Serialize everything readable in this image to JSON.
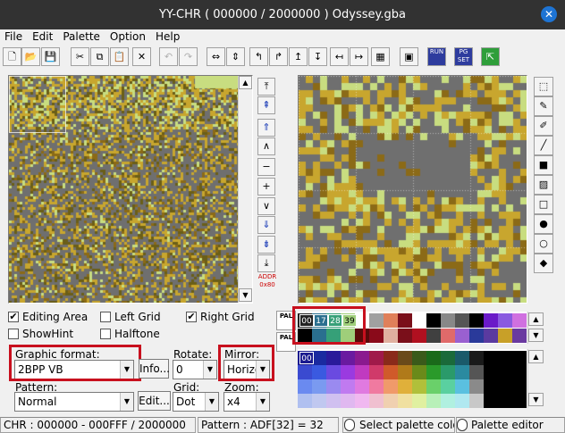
{
  "window": {
    "title": "YY-CHR ( 000000 / 2000000 ) Odyssey.gba",
    "close_glyph": "✕"
  },
  "menu": [
    "File",
    "Edit",
    "Palette",
    "Option",
    "Help"
  ],
  "toolbar": {
    "buttons": [
      {
        "name": "new-file-icon",
        "glyph": "🗋",
        "enabled": true
      },
      {
        "name": "open-folder-icon",
        "glyph": "📂",
        "enabled": true
      },
      {
        "name": "save-icon",
        "glyph": "💾",
        "enabled": true
      },
      {
        "name": "cut-icon",
        "glyph": "✂",
        "enabled": true
      },
      {
        "name": "copy-icon",
        "glyph": "⧉",
        "enabled": true
      },
      {
        "name": "paste-icon",
        "glyph": "📋",
        "enabled": true
      },
      {
        "name": "delete-icon",
        "glyph": "✕",
        "enabled": true
      },
      {
        "name": "undo-icon",
        "glyph": "↶",
        "enabled": false
      },
      {
        "name": "redo-icon",
        "glyph": "↷",
        "enabled": false
      },
      {
        "name": "flip-horizontal-icon",
        "glyph": "⇔",
        "enabled": true
      },
      {
        "name": "flip-vertical-icon",
        "glyph": "⇕",
        "enabled": true
      },
      {
        "name": "rotate-left-icon",
        "glyph": "↰",
        "enabled": true
      },
      {
        "name": "rotate-right-icon",
        "glyph": "↱",
        "enabled": true
      },
      {
        "name": "shift-up-icon",
        "glyph": "↥",
        "enabled": true
      },
      {
        "name": "shift-down-icon",
        "glyph": "↧",
        "enabled": true
      },
      {
        "name": "shift-left-icon",
        "glyph": "↤",
        "enabled": true
      },
      {
        "name": "shift-right-icon",
        "glyph": "↦",
        "enabled": true
      },
      {
        "name": "palette-grid-icon",
        "glyph": "▦",
        "enabled": true
      },
      {
        "name": "screenshot-icon",
        "glyph": "▣",
        "enabled": true
      },
      {
        "name": "run-icon",
        "glyph": "RUN",
        "enabled": true
      },
      {
        "name": "pg-set-icon",
        "glyph": "PG SET",
        "enabled": true
      },
      {
        "name": "exit-icon",
        "glyph": "⇱",
        "enabled": true
      }
    ]
  },
  "nav": {
    "buttons": [
      "⤒",
      "⇞",
      "⇑",
      "∧",
      "−",
      "+",
      "∨",
      "⇓",
      "⇟",
      "⤓"
    ],
    "addr_label": "ADDR 0x80"
  },
  "checkboxes": {
    "editing_area": {
      "label": "Editing Area",
      "checked": true
    },
    "show_hint": {
      "label": "ShowHint",
      "checked": false
    },
    "left_grid": {
      "label": "Left Grid",
      "checked": false
    },
    "halftone": {
      "label": "Halftone",
      "checked": false
    },
    "right_grid": {
      "label": "Right Grid",
      "checked": true
    }
  },
  "controls": {
    "graphic_format": {
      "label": "Graphic format:",
      "value": "2BPP VB"
    },
    "info_button": "Info...",
    "rotate": {
      "label": "Rotate:",
      "value": "0"
    },
    "mirror": {
      "label": "Mirror:",
      "value": "Horizo"
    },
    "pattern": {
      "label": "Pattern:",
      "value": "Normal"
    },
    "edit_button": "Edit...",
    "grid": {
      "label": "Grid:",
      "value": "Dot"
    },
    "zoom": {
      "label": "Zoom:",
      "value": "x4"
    }
  },
  "palette": {
    "tab_labels": [
      "PAL",
      "PAL"
    ],
    "selected_labels": [
      "00",
      "17",
      "28",
      "39"
    ],
    "row2_label": "00",
    "colors": {
      "c0": "#6f6f6f",
      "c1": "#c8a62e",
      "c2": "#6a5e18",
      "c3": "#c8dd80",
      "c4": "#8b6a17"
    }
  },
  "status": {
    "chr": "CHR : 000000 - 000FFF / 2000000",
    "pattern": "Pattern : ADF[32] = 32",
    "select_palette": "Select palette color",
    "palette_editor": "Palette editor"
  }
}
